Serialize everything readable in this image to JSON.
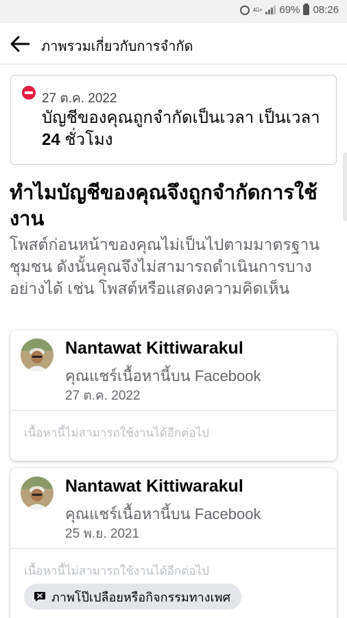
{
  "status_bar": {
    "network": "4G+",
    "battery": "69%",
    "time": "08:26"
  },
  "appbar": {
    "title": "ภาพรวมเกี่ยวกับการจำกัด"
  },
  "notice": {
    "date": "27 ต.ค. 2022",
    "message_prefix": "บัญชีของคุณถูกจำกัดเป็นเวลา เป็นเวลา ",
    "message_bold": "24",
    "message_suffix": " ชั่วโมง"
  },
  "why": {
    "heading": "ทำไมบัญชีของคุณจึงถูกจำกัดการใช้งาน",
    "description": "โพสต์ก่อนหน้าของคุณไม่เป็นไปตามมาตรฐานชุมชน ดังนั้นคุณจึงไม่สามารถดำเนินการบางอย่างได้ เช่น โพสต์หรือแสดงความคิดเห็น"
  },
  "posts": [
    {
      "author": "Nantawat Kittiwarakul",
      "subtitle": "คุณแชร์เนื้อหานี้บน Facebook",
      "date": "27 ต.ค. 2022",
      "unavailable": "เนื้อหานี้ไม่สามารถใช้งานได้อีกต่อไป"
    },
    {
      "author": "Nantawat Kittiwarakul",
      "subtitle": "คุณแชร์เนื้อหานี้บน Facebook",
      "date": "25 พ.ย. 2021",
      "unavailable": "เนื้อหานี้ไม่สามารถใช้งานได้อีกต่อไป",
      "reason": "ภาพโป๊เปลือยหรือกิจกรรมทางเพศ"
    }
  ],
  "icons": {
    "back": "arrow-left-icon",
    "restriction": "no-entry-icon",
    "reason": "speech-bubble-x-icon"
  },
  "colors": {
    "restriction_red": "#e41e3f",
    "secondary_text": "#65676b",
    "chip_background": "#e4e6eb"
  }
}
